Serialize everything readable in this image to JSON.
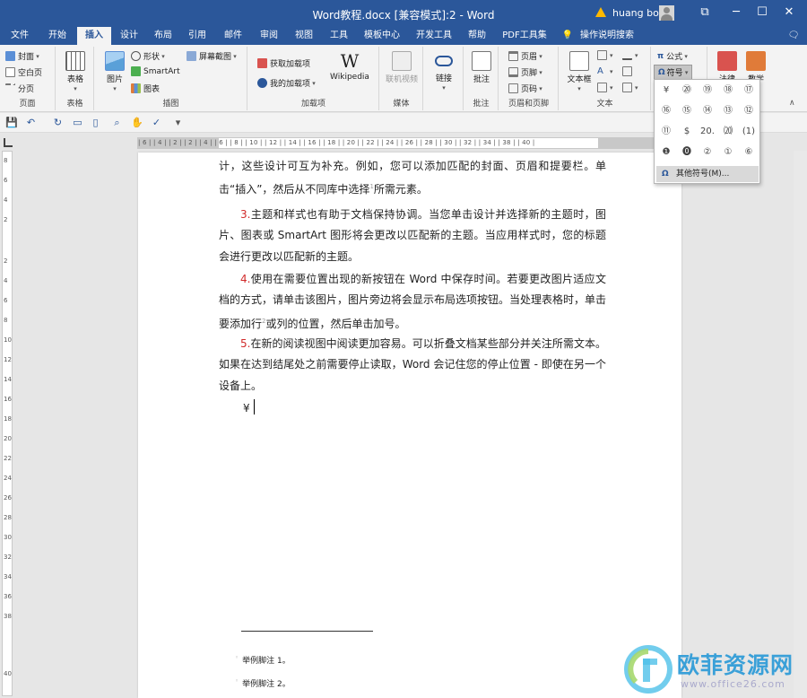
{
  "titlebar": {
    "title": "Word教程.docx [兼容模式]:2  -  Word",
    "user": "huang bo",
    "min": "─",
    "max": "☐",
    "close": "✕",
    "restore_glyph": "⧉"
  },
  "tabs": [
    "文件",
    "开始",
    "插入",
    "设计",
    "布局",
    "引用",
    "邮件",
    "审阅",
    "视图",
    "工具",
    "模板中心",
    "开发工具",
    "帮助",
    "PDF工具集",
    "操作说明搜索"
  ],
  "active_tab": "插入",
  "ribbon": {
    "pages_group": {
      "label": "页面",
      "items": [
        "封面",
        "空白页",
        "分页"
      ]
    },
    "tables_group": {
      "label": "表格",
      "button": "表格"
    },
    "illustrations_group": {
      "label": "插图",
      "picture": "图片",
      "shapes": "形状",
      "smartart": "SmartArt",
      "chart": "图表",
      "screenshot": "屏幕截图"
    },
    "addins_group": {
      "label": "加载项",
      "get_addins": "获取加载项",
      "my_addins": "我的加载项",
      "wikipedia": "Wikipedia"
    },
    "media_group": {
      "label": "媒体",
      "online_video": "联机视频"
    },
    "links_group": {
      "button": "链接"
    },
    "comments_group": {
      "label": "批注",
      "button": "批注"
    },
    "header_footer_group": {
      "label": "页眉和页脚",
      "header": "页眉",
      "footer": "页脚",
      "page_number": "页码"
    },
    "text_group": {
      "label": "文本",
      "textbox": "文本框"
    },
    "symbols_group": {
      "equation": "公式",
      "symbol": "符号"
    },
    "extra": {
      "law": "法律",
      "teach": "教学"
    }
  },
  "symbol_menu": {
    "rows": [
      [
        "¥",
        "⑳",
        "⑲",
        "⑱",
        "⑰"
      ],
      [
        "⑯",
        "⑮",
        "⑭",
        "⑬",
        "⑫"
      ],
      [
        "⑪",
        "$",
        "20.",
        "⒇",
        "(1)"
      ],
      [
        "❶",
        "⓿",
        "②",
        "①",
        "⑥"
      ]
    ],
    "more": "其他符号(M)..."
  },
  "document": {
    "para1": "计，这些设计可互为补充。例如，您可以添加匹配的封面、页眉和提要栏。单击“插入”，然后从不同库中选择",
    "para1_tail": "所需元素。",
    "para2_num": "3.",
    "para2": "主题和样式也有助于文档保持协调。当您单击设计并选择新的主题时，图片、图表或 SmartArt 图形将会更改以匹配新的主题。当应用样式时，您的标题会进行更改以匹配新的主题。",
    "para3_num": "4.",
    "para3": "使用在需要位置出现的新按钮在 Word 中保存时间。若要更改图片适应文档的方式，请单击该图片，图片旁边将会显示布局选项按钮。当处理表格时，单击要添加行",
    "para3_tail": "或列的位置，然后单击加号。",
    "para4_num": "5.",
    "para4": "在新的阅读视图中阅读更加容易。可以折叠文档某些部分并关注所需文本。如果在达到结尾处之前需要停止读取，Word 会记住您的停止位置 - 即使在另一个设备上。",
    "inserted_symbol": "¥",
    "fn_ref1": "1",
    "fn_ref2": "2",
    "footnote1": "举例脚注 1。",
    "footnote2": "举例脚注 2。"
  },
  "ruler": {
    "h_ticks": "| 6 |  | 4 |  | 2 |    | 2 |  | 4 |  | 6 |  | 8 |  | 10 |  | 12 |  | 14 |  | 16 |  | 18 |  | 20 |  | 22 |  | 24 |  | 26 |  | 28 |  | 30 |  | 32 |  | 34 |    | 38 |  | 40 |",
    "v_ticks": [
      "8",
      "6",
      "4",
      "2",
      "2",
      "4",
      "6",
      "8",
      "10",
      "12",
      "14",
      "16",
      "18",
      "20",
      "22",
      "24",
      "26",
      "28",
      "30",
      "32",
      "34",
      "36",
      "38",
      "40"
    ]
  },
  "watermark": {
    "text": "欧菲资源网",
    "url": "www.office26.com"
  },
  "colors": {
    "brand": "#2b579a",
    "red_number": "#d12a2a",
    "warn": "#ffb900"
  }
}
